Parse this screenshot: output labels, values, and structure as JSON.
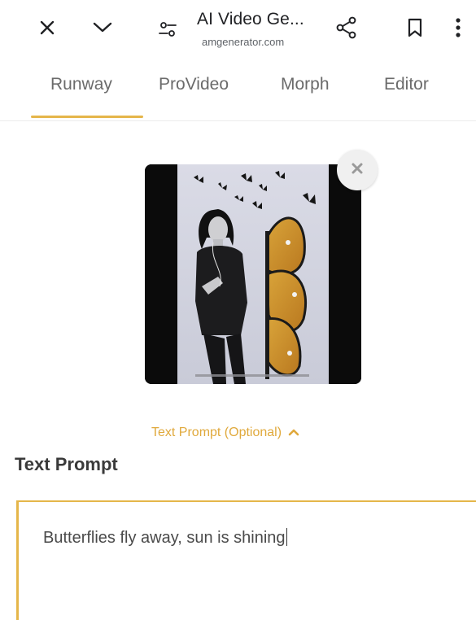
{
  "browser": {
    "page_title": "AI Video Ge...",
    "domain": "amgenerator.com",
    "icons": {
      "close": "close-icon",
      "collapse": "chevron-down-icon",
      "site_settings": "tune-icon",
      "share": "share-icon",
      "bookmark": "bookmark-icon",
      "more": "more-vert-icon"
    }
  },
  "tabs": [
    {
      "label": "Runway",
      "active": true
    },
    {
      "label": "ProVideo",
      "active": false
    },
    {
      "label": "Morph",
      "active": false
    },
    {
      "label": "Editor",
      "active": false
    }
  ],
  "preview": {
    "remove_icon": "close-icon"
  },
  "prompt": {
    "toggle_label": "Text Prompt (Optional)",
    "heading": "Text Prompt",
    "value": "Butterflies fly away, sun is shining"
  },
  "colors": {
    "accent": "#e5b64a",
    "accent_text": "#e0a93c",
    "tab_text": "#6b6b6b"
  }
}
